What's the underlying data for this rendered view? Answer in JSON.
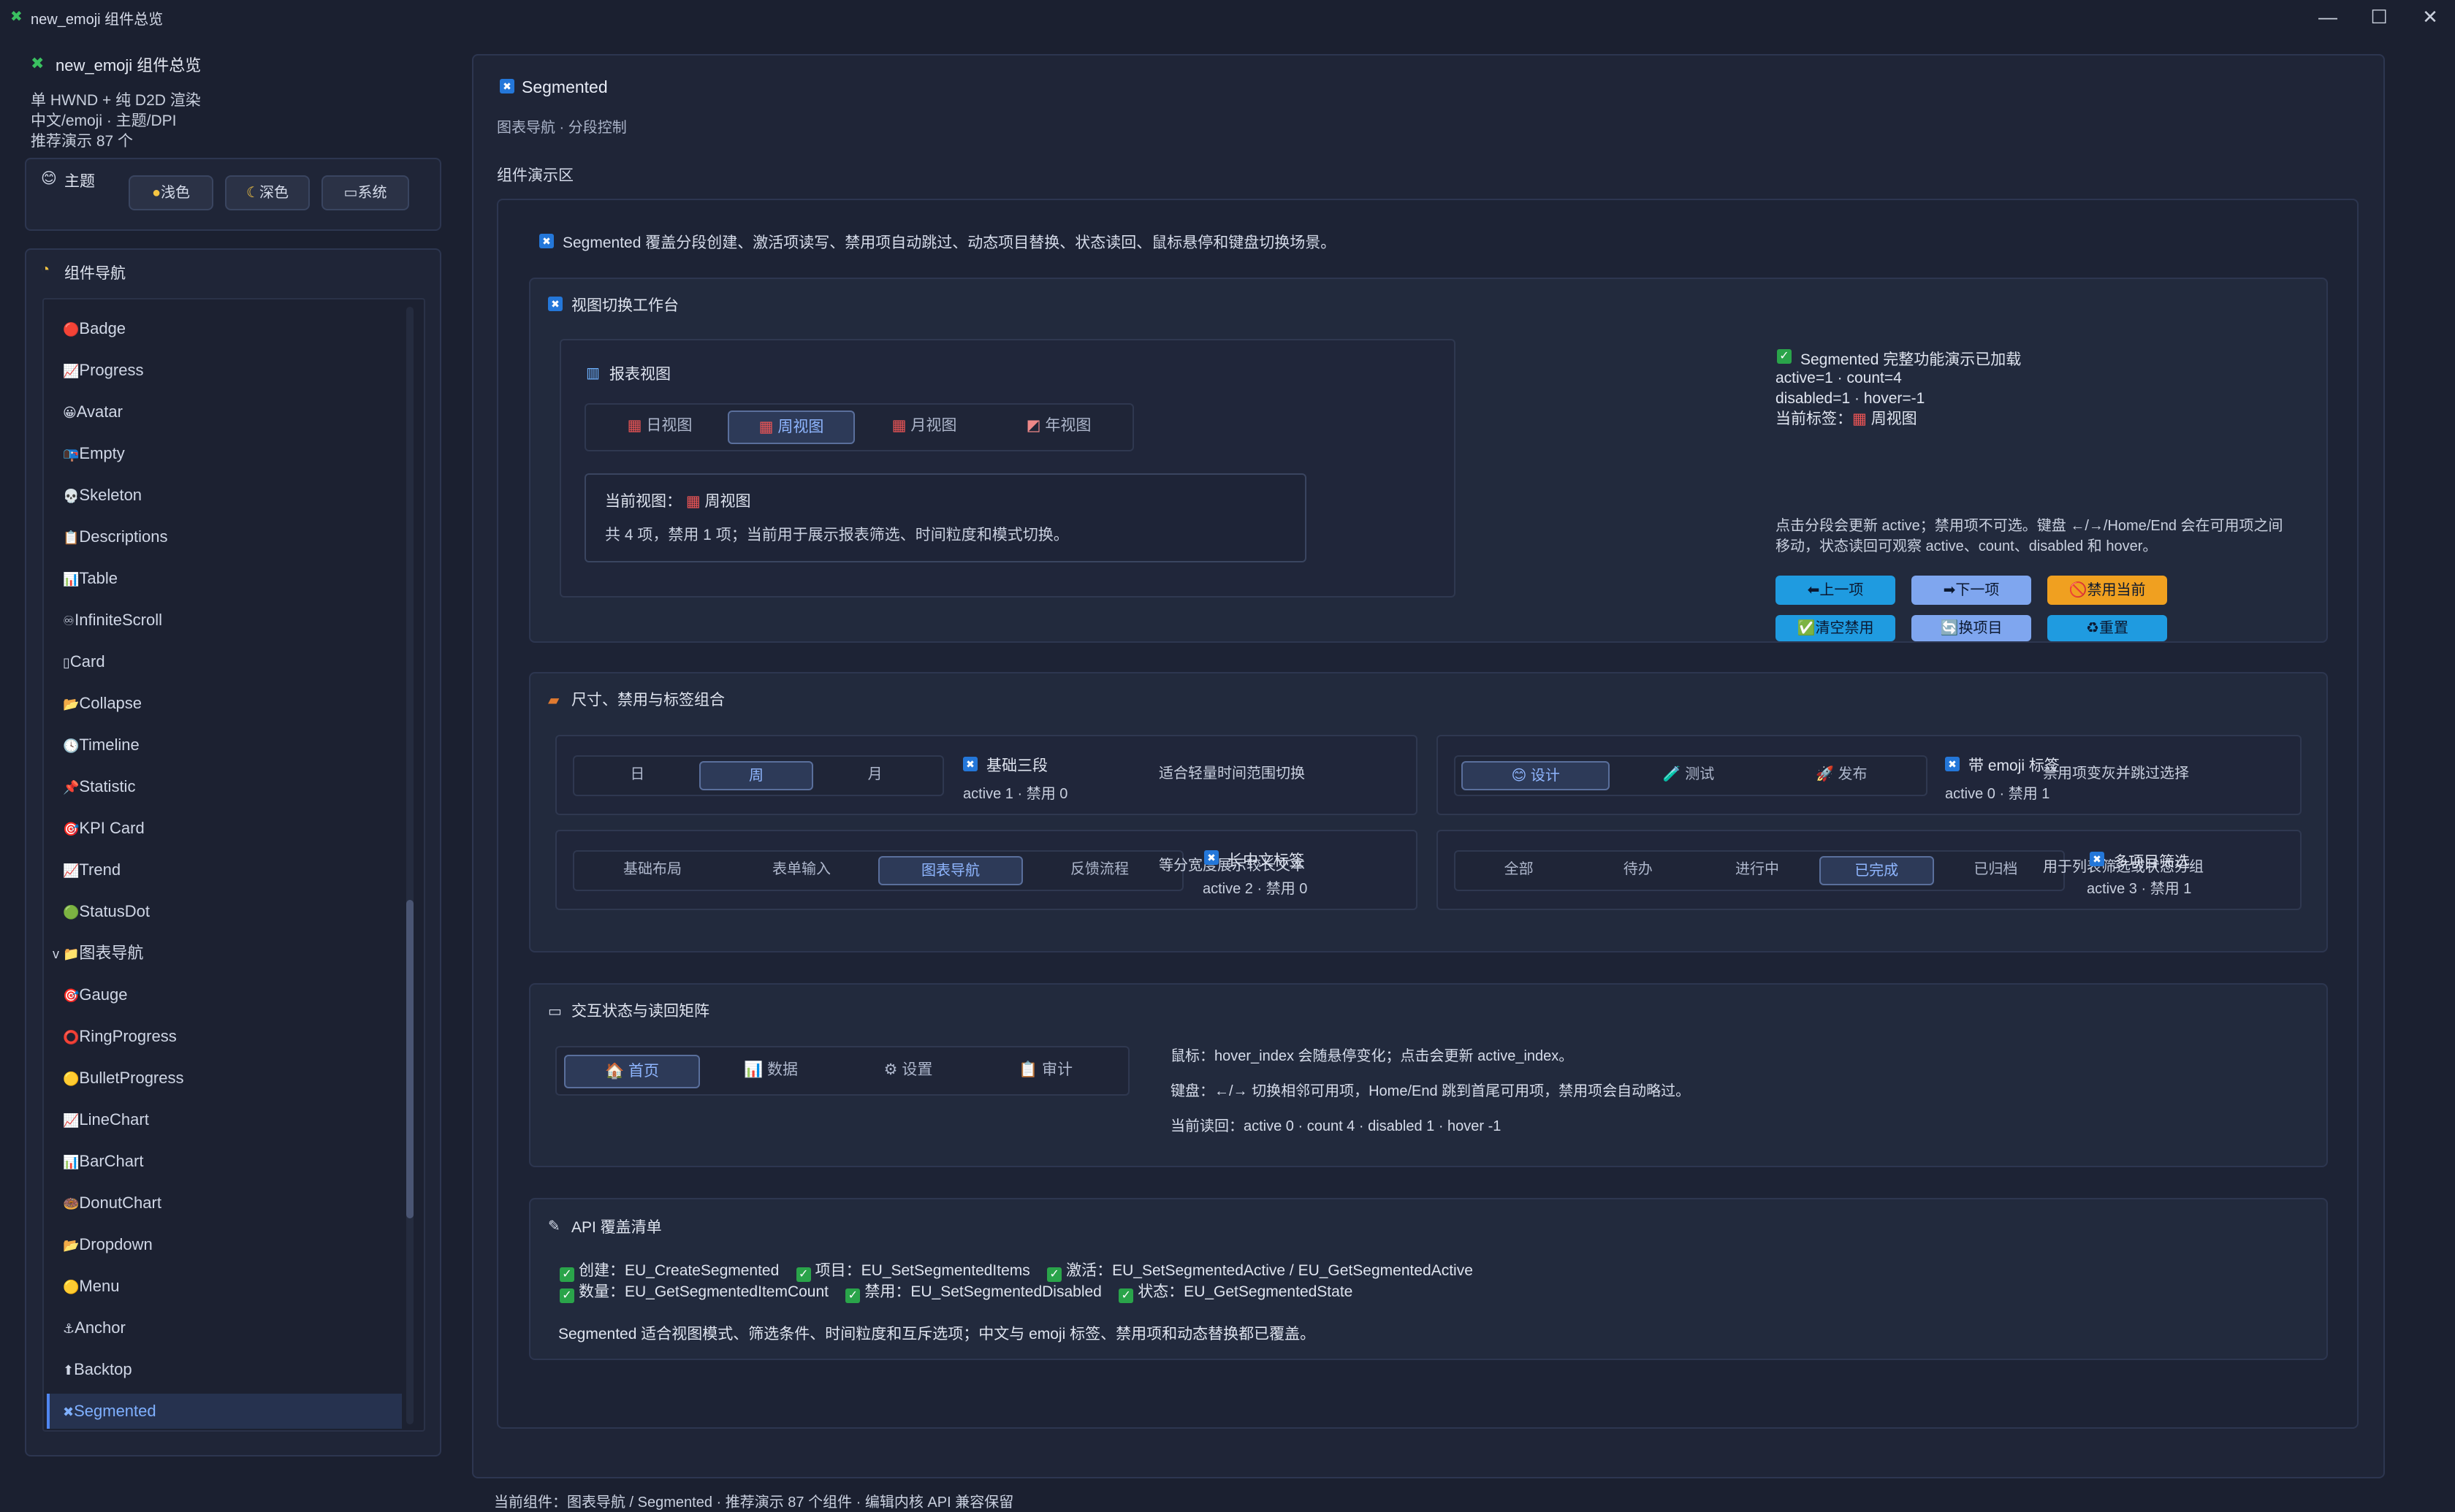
{
  "window": {
    "title": "new_emoji 组件总览",
    "min": "—",
    "max": "☐",
    "close": "✕"
  },
  "sidebar": {
    "app_title": "new_emoji 组件总览",
    "info_lines": [
      "单 HWND + 纯 D2D 渲染",
      "中文/emoji · 主题/DPI",
      "推荐演示 87 个"
    ],
    "theme_title": "主题",
    "theme_buttons": [
      "浅色",
      "深色",
      "系统"
    ],
    "nav_title": "组件导航",
    "nav_items": [
      {
        "icon": "🔴",
        "label": "Badge"
      },
      {
        "icon": "📈",
        "label": "Progress"
      },
      {
        "icon": "😀",
        "label": "Avatar"
      },
      {
        "icon": "📭",
        "label": "Empty"
      },
      {
        "icon": "💀",
        "label": "Skeleton"
      },
      {
        "icon": "📋",
        "label": "Descriptions"
      },
      {
        "icon": "📊",
        "label": "Table"
      },
      {
        "icon": "♾",
        "label": "InfiniteScroll"
      },
      {
        "icon": "▯",
        "label": "Card"
      },
      {
        "icon": "📂",
        "label": "Collapse"
      },
      {
        "icon": "🕓",
        "label": "Timeline"
      },
      {
        "icon": "📌",
        "label": "Statistic"
      },
      {
        "icon": "🎯",
        "label": "KPI Card"
      },
      {
        "icon": "📈",
        "label": "Trend"
      },
      {
        "icon": "🟢",
        "label": "StatusDot"
      },
      {
        "icon": "v 📁",
        "label": "图表导航"
      },
      {
        "icon": "🎯",
        "label": "Gauge"
      },
      {
        "icon": "⭕",
        "label": "RingProgress"
      },
      {
        "icon": "🟡",
        "label": "BulletProgress"
      },
      {
        "icon": "📈",
        "label": "LineChart"
      },
      {
        "icon": "📊",
        "label": "BarChart"
      },
      {
        "icon": "🍩",
        "label": "DonutChart"
      },
      {
        "icon": "📂",
        "label": "Dropdown"
      },
      {
        "icon": "🟡",
        "label": "Menu"
      },
      {
        "icon": "⚓",
        "label": "Anchor"
      },
      {
        "icon": "⬆",
        "label": "Backtop"
      },
      {
        "icon": "✖",
        "label": "Segmented"
      }
    ]
  },
  "main": {
    "title": "Segmented",
    "subtitle": "图表导航 · 分段控制",
    "demo_label": "组件演示区",
    "intro": "Segmented 覆盖分段创建、激活项读写、禁用项自动跳过、动态项目替换、状态读回、鼠标悬停和键盘切换场景。",
    "workbench": {
      "title": "视图切换工作台",
      "report_title": "报表视图",
      "tabs": [
        "日视图",
        "周视图",
        "月视图",
        "年视图"
      ],
      "tab_icons": [
        "📅",
        "📅",
        "📅",
        "📈"
      ],
      "current_label": "当前视图：",
      "current_value": "周视图",
      "desc": "共 4 项，禁用 1 项；当前用于展示报表筛选、时间粒度和模式切换。",
      "status_title": "Segmented 完整功能演示已加载",
      "status_line1": "active=1 · count=4",
      "status_line2": "disabled=1 · hover=-1",
      "status_line3_label": "当前标签：",
      "status_line3_value": "周视图",
      "hint1": "点击分段会更新 active；禁用项不可选。键盘 ←/→/Home/End 会在可用项之间",
      "hint2": "移动，状态读回可观察 active、count、disabled 和 hover。",
      "buttons": [
        {
          "label": "⬅上一项",
          "color": "#1f9be0"
        },
        {
          "label": "➡下一项",
          "color": "#7fa6ef"
        },
        {
          "label": "🚫禁用当前",
          "color": "#f0a020"
        },
        {
          "label": "✅清空禁用",
          "color": "#1f9be0"
        },
        {
          "label": "🔄换项目",
          "color": "#7fa6ef"
        },
        {
          "label": "♻重置",
          "color": "#1f9be0"
        }
      ]
    },
    "sizes": {
      "title": "尺寸、禁用与标签组合",
      "card1": {
        "items": [
          "日",
          "周",
          "月"
        ],
        "label": "基础三段",
        "state": "active 1 · 禁用 0",
        "note": "适合轻量时间范围切换"
      },
      "card2": {
        "items": [
          "😊 设计",
          "🧪 测试",
          "🚀 发布"
        ],
        "label": "带 emoji 标签",
        "state": "active 0 · 禁用 1",
        "note": "禁用项变灰并跳过选择"
      },
      "card3": {
        "items": [
          "基础布局",
          "表单输入",
          "图表导航",
          "反馈流程"
        ],
        "label": "长中文标签",
        "state": "active 2 · 禁用 0",
        "note": "等分宽度展示较长文本"
      },
      "card4": {
        "items": [
          "全部",
          "待办",
          "进行中",
          "已完成",
          "已归档"
        ],
        "label": "多项目筛选",
        "state": "active 3 · 禁用 1",
        "note": "用于列表筛选或状态分组"
      }
    },
    "interaction": {
      "title": "交互状态与读回矩阵",
      "items": [
        "🏠 首页",
        "📊 数据",
        "⚙ 设置",
        "📋 审计"
      ],
      "line1": "鼠标：hover_index 会随悬停变化；点击会更新 active_index。",
      "line2": "键盘：←/→ 切换相邻可用项，Home/End 跳到首尾可用项，禁用项会自动略过。",
      "line3": "当前读回：active 0 · count 4 · disabled 1 · hover -1"
    },
    "api": {
      "title": "API 覆盖清单",
      "row1": [
        "创建：EU_CreateSegmented",
        "项目：EU_SetSegmentedItems",
        "激活：EU_SetSegmentedActive / EU_GetSegmentedActive"
      ],
      "row2": [
        "数量：EU_GetSegmentedItemCount",
        "禁用：EU_SetSegmentedDisabled",
        "状态：EU_GetSegmentedState"
      ],
      "summary": "Segmented 适合视图模式、筛选条件、时间粒度和互斥选项；中文与 emoji 标签、禁用项和动态替换都已覆盖。"
    }
  },
  "statusbar": "当前组件：图表导航 / Segmented · 推荐演示 87 个组件 · 编辑内核 API 兼容保留"
}
